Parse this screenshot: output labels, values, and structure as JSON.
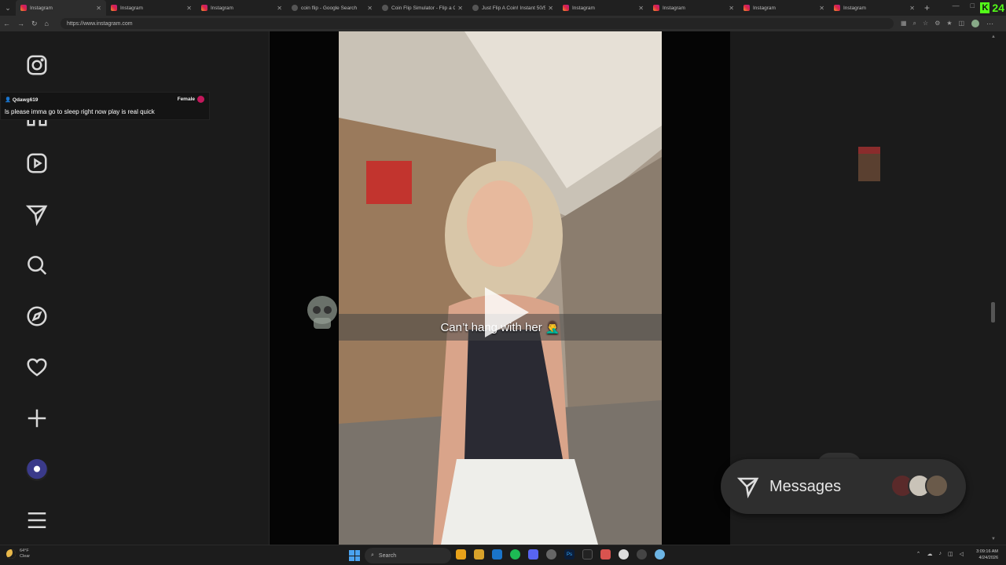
{
  "browser": {
    "tabs": [
      {
        "title": "Instagram",
        "favicon": "instagram-icon",
        "active": true
      },
      {
        "title": "Instagram",
        "favicon": "instagram-icon"
      },
      {
        "title": "Instagram",
        "favicon": "instagram-icon"
      },
      {
        "title": "coin flip - Google Search",
        "favicon": "google-icon"
      },
      {
        "title": "Coin Flip Simulator - Flip a Coin",
        "favicon": "coin-icon"
      },
      {
        "title": "Just Flip A Coin! Instant 50/50 C",
        "favicon": "coin-icon"
      },
      {
        "title": "Instagram",
        "favicon": "instagram-icon"
      },
      {
        "title": "Instagram",
        "favicon": "instagram-icon"
      },
      {
        "title": "Instagram",
        "favicon": "instagram-icon"
      },
      {
        "title": "Instagram",
        "favicon": "instagram-icon"
      }
    ],
    "new_tab": "+",
    "url": "https://www.instagram.com",
    "brand_letter": "K",
    "brand_count": "24"
  },
  "overlay_chat": {
    "username": "Qdawg619",
    "gender": "Female",
    "message": "ls please imma go to sleep right now play is real quick"
  },
  "sidebar": {
    "items": [
      "instagram-logo-icon",
      "home-icon",
      "reels-icon",
      "direct-icon",
      "search-icon",
      "explore-icon",
      "notifications-heart-icon",
      "create-plus-icon",
      "profile-avatar",
      "more-menu-icon"
    ]
  },
  "video": {
    "caption": "Can’t hang with her 🤦‍♂️",
    "state": "paused"
  },
  "messages_dock": {
    "label": "Messages",
    "avatar_colors": [
      "#5a2a2a",
      "#c9c3b8",
      "#6a5a4a"
    ]
  },
  "taskbar": {
    "weather_temp": "64°F",
    "weather_desc": "Clear",
    "search_placeholder": "Search",
    "time": "3:09:16 AM",
    "date": "4/24/2026"
  },
  "colors": {
    "brand_green": "#53fc18",
    "instagram_gradient": [
      "#f09433",
      "#dc2743",
      "#bc1888"
    ],
    "panel_bg": "#1b1b1b"
  }
}
